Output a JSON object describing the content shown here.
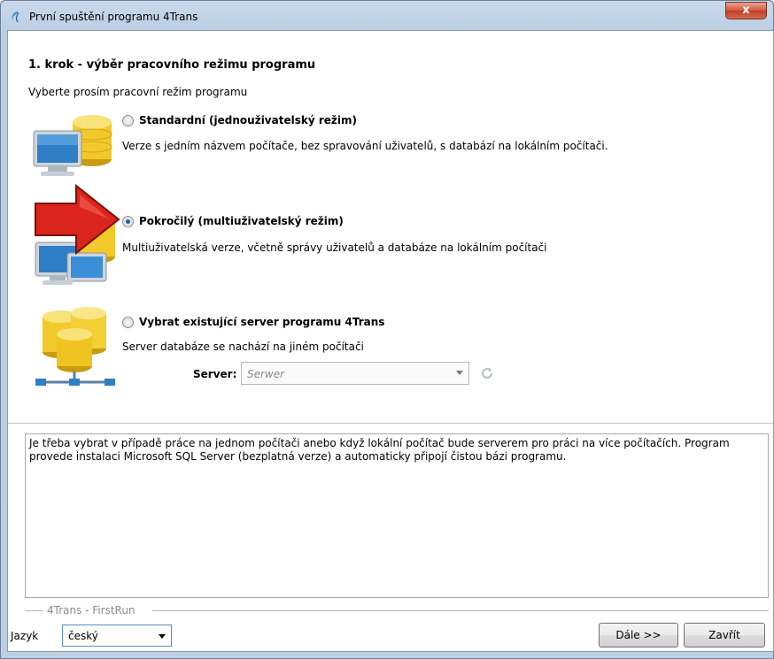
{
  "window": {
    "title": "První spuštění programu 4Trans",
    "close_label": "x"
  },
  "step": {
    "title": "1. krok - výběr pracovního režimu programu",
    "subtitle": "Vyberte prosím pracovní režim programu"
  },
  "options": [
    {
      "label": "Standardní (jednouživatelský režim)",
      "description": "Verze s jedním názvem počítače, bez spravování uživatelů, s databází na lokálním počítači.",
      "selected": false
    },
    {
      "label": "Pokročilý (multiuživatelský režim)",
      "description": "Multiuživatelská verze, včetně správy uživatelů a databáze na lokálním počítači",
      "selected": true
    },
    {
      "label": "Vybrat existující server programu 4Trans",
      "description": "Server databáze se nachází na jiném počítači",
      "selected": false
    }
  ],
  "server": {
    "label": "Server:",
    "placeholder": "Serwer"
  },
  "info_text": "Je třeba vybrat v případě práce na jednom počítači anebo když lokální počítač bude serverem pro práci na více počítačích. Program provede instalaci Microsoft SQL Server (bezplatná verze) a automaticky připojí čistou bázi programu.",
  "footer": {
    "group_label": "4Trans - FirstRun",
    "language_label": "Jazyk",
    "language_value": "český",
    "next_label": "Dále >>",
    "close_label": "Zavřít"
  },
  "colors": {
    "arrow_red": "#d9251c",
    "db_gold": "#f2c92b",
    "monitor_blue": "#2f7fc6"
  }
}
